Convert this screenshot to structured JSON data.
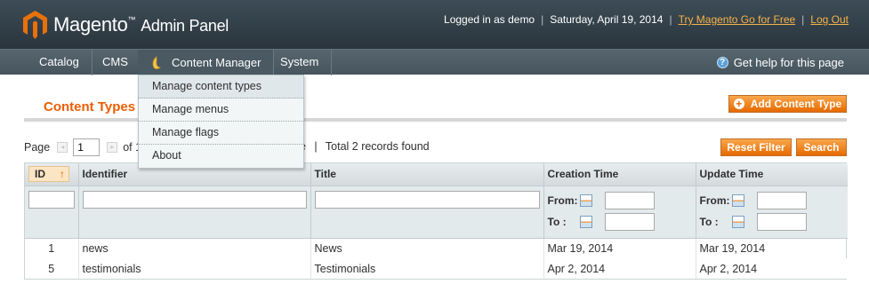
{
  "header": {
    "app_name": "Magento",
    "tm": "™",
    "subtitle": "Admin Panel",
    "logged_in": "Logged in as demo",
    "date": "Saturday, April 19, 2014",
    "try_link": "Try Magento Go for Free",
    "logout_link": "Log Out",
    "separator": "|"
  },
  "nav": {
    "items": [
      "Catalog",
      "CMS",
      "Content Manager",
      "System"
    ],
    "help": "Get help for this page",
    "help_icon_glyph": "?"
  },
  "dropdown": {
    "items": [
      "Manage content types",
      "Manage menus",
      "Manage flags",
      "About"
    ]
  },
  "page": {
    "title": "Content Types",
    "add_button": "Add Content Type",
    "plus_glyph": "+"
  },
  "pager": {
    "page_label": "Page",
    "page_value": "1",
    "of_label": "of 1",
    "right_text": "ge",
    "separator": "|",
    "total": "Total 2 records found",
    "prev_glyph": "◂",
    "next_glyph": "▸"
  },
  "actions": {
    "reset": "Reset Filter",
    "search": "Search"
  },
  "grid": {
    "columns": [
      "ID",
      "Identifier",
      "Title",
      "Creation Time",
      "Update Time"
    ],
    "sort_glyph": "↑",
    "from_label": "From:",
    "to_label": "To :",
    "rows": [
      {
        "id": "1",
        "identifier": "news",
        "title": "News",
        "created": "Mar 19, 2014",
        "updated": "Mar 19, 2014"
      },
      {
        "id": "5",
        "identifier": "testimonials",
        "title": "Testimonials",
        "created": "Apr 2, 2014",
        "updated": "Apr 2, 2014"
      }
    ]
  },
  "colors": {
    "accent": "#eb5e00",
    "header_bg": "#2e3a42",
    "nav_bg": "#4f5e67",
    "link": "#f6b44a"
  },
  "icons": {
    "logo": "magento-logo-icon",
    "content_manager": "content-manager-icon",
    "help": "help-icon",
    "add": "plus-icon",
    "sort": "sort-ascending-icon",
    "calendar": "calendar-icon"
  }
}
